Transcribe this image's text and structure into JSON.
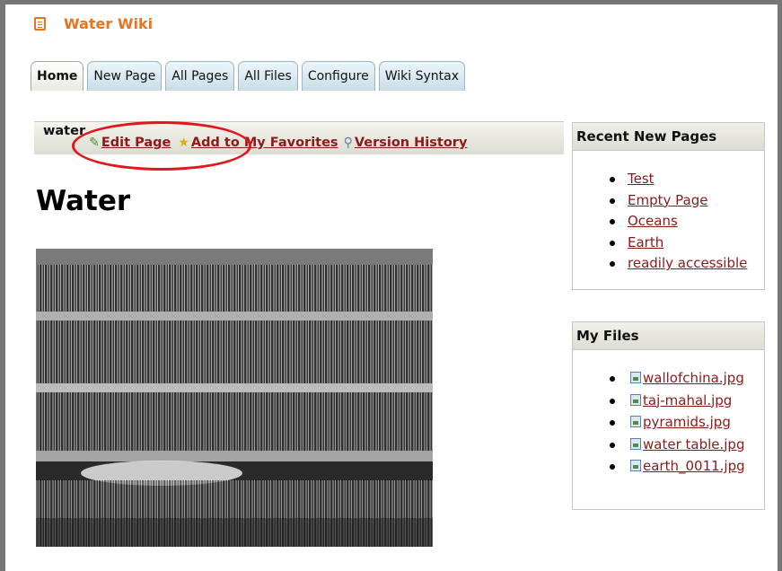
{
  "app": {
    "title": "Water Wiki",
    "icon": "notepad-icon",
    "accent_color": "#e8731f"
  },
  "tabs": [
    {
      "label": "Home",
      "active": true
    },
    {
      "label": "New Page",
      "active": false
    },
    {
      "label": "All Pages",
      "active": false
    },
    {
      "label": "All Files",
      "active": false
    },
    {
      "label": "Configure",
      "active": false
    },
    {
      "label": "Wiki Syntax",
      "active": false
    }
  ],
  "page_bar": {
    "page_name": "water",
    "edit_label": "Edit Page",
    "favorites_label": "Add to My Favorites",
    "history_label": "Version History",
    "highlight_color": "#e0181b"
  },
  "page": {
    "heading": "Water"
  },
  "recent_pages": {
    "title": "Recent New Pages",
    "items": [
      "Test",
      "Empty Page",
      "Oceans",
      "Earth",
      "readily accessible"
    ]
  },
  "my_files": {
    "title": "My Files",
    "items": [
      "wallofchina.jpg",
      "taj-mahal.jpg",
      "pyramids.jpg",
      "water table.jpg",
      "earth_0011.jpg"
    ]
  },
  "link_color": "#8b1a1a"
}
